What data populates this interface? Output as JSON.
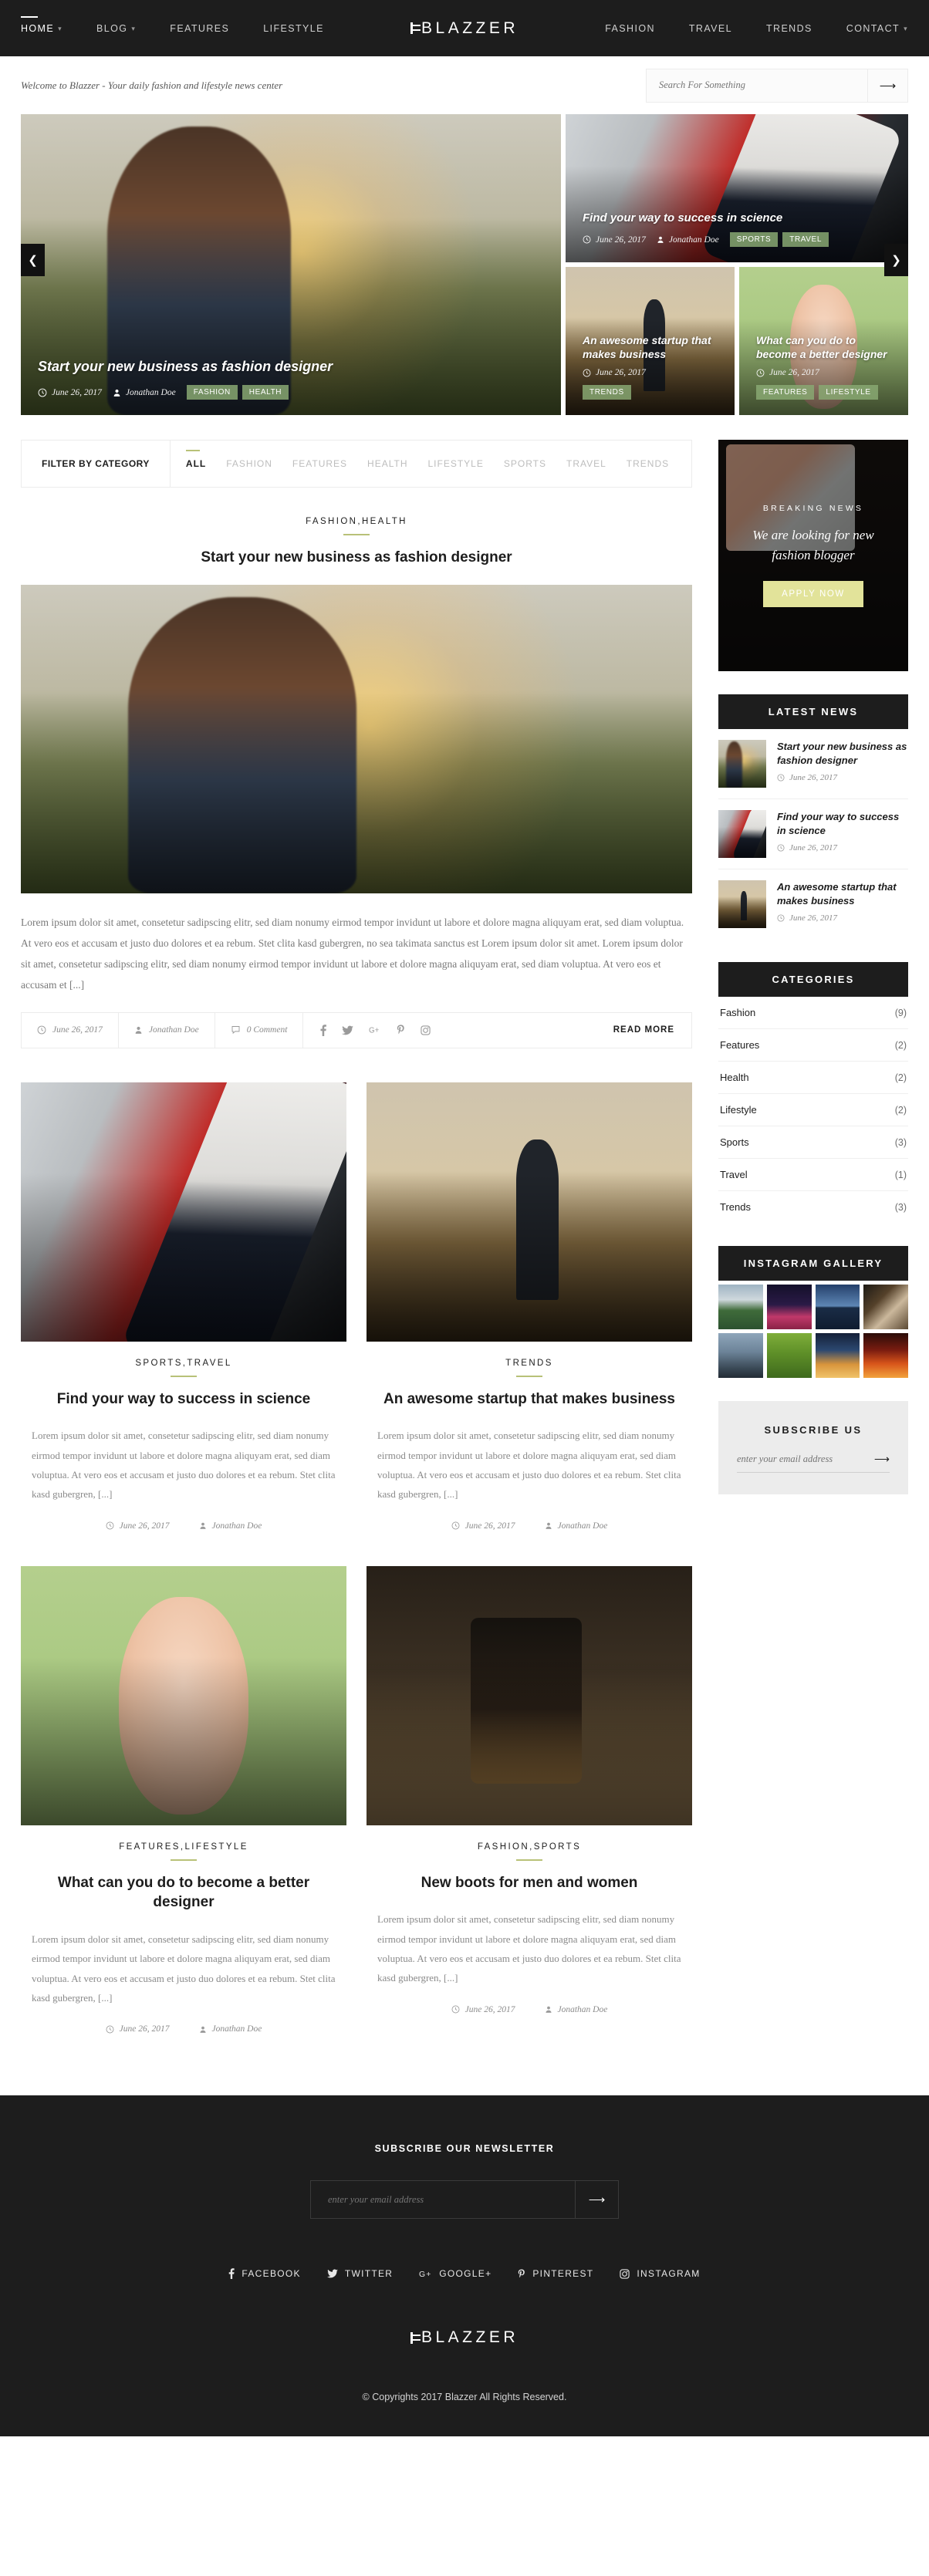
{
  "nav": {
    "left": [
      {
        "label": "HOME",
        "active": true,
        "caret": true
      },
      {
        "label": "BLOG",
        "active": false,
        "caret": true
      },
      {
        "label": "FEATURES",
        "active": false,
        "caret": false
      },
      {
        "label": "LIFESTYLE",
        "active": false,
        "caret": false
      }
    ],
    "brand": "BLAZZER",
    "right": [
      {
        "label": "FASHION",
        "active": false,
        "caret": false
      },
      {
        "label": "TRAVEL",
        "active": false,
        "caret": false
      },
      {
        "label": "TRENDS",
        "active": false,
        "caret": false
      },
      {
        "label": "CONTACT",
        "active": false,
        "caret": true
      }
    ]
  },
  "welcome": {
    "text": "Welcome to Blazzer - Your daily fashion and lifestyle news center",
    "search_placeholder": "Search For Something",
    "search_value": "",
    "search_icon": "arrow-right-icon"
  },
  "hero": {
    "prev_icon": "chevron-left-icon",
    "next_icon": "chevron-right-icon",
    "main": {
      "title": "Start your new business as fashion designer",
      "date": "June 26, 2017",
      "author": "Jonathan Doe",
      "tags": [
        "FASHION",
        "HEALTH"
      ]
    },
    "top": {
      "title": "Find your way to success in science",
      "date": "June 26, 2017",
      "author": "Jonathan Doe",
      "tags": [
        "SPORTS",
        "TRAVEL"
      ]
    },
    "small": [
      {
        "title": "An awesome startup that makes business",
        "date": "June 26, 2017",
        "tags": [
          "TRENDS"
        ]
      },
      {
        "title": "What can you do to become a better designer",
        "date": "June 26, 2017",
        "tags": [
          "FEATURES",
          "LIFESTYLE"
        ]
      }
    ]
  },
  "filter": {
    "label": "FILTER BY CATEGORY",
    "items": [
      {
        "label": "ALL",
        "active": true
      },
      {
        "label": "FASHION",
        "active": false
      },
      {
        "label": "FEATURES",
        "active": false
      },
      {
        "label": "HEALTH",
        "active": false
      },
      {
        "label": "LIFESTYLE",
        "active": false
      },
      {
        "label": "SPORTS",
        "active": false
      },
      {
        "label": "TRAVEL",
        "active": false
      },
      {
        "label": "TRENDS",
        "active": false
      }
    ]
  },
  "featured_post": {
    "categories": "FASHION,HEALTH",
    "title": "Start your new business as fashion designer",
    "excerpt": "Lorem ipsum dolor sit amet, consetetur sadipscing elitr, sed diam nonumy eirmod tempor invidunt ut labore et dolore magna aliquyam erat, sed diam voluptua. At vero eos et accusam et justo duo dolores et ea rebum. Stet clita kasd gubergren, no sea takimata sanctus est Lorem ipsum dolor sit amet. Lorem ipsum dolor sit amet, consetetur sadipscing elitr, sed diam nonumy eirmod tempor invidunt ut labore et dolore magna aliquyam erat, sed diam voluptua. At vero eos et accusam et [...]",
    "date": "June 26, 2017",
    "author": "Jonathan Doe",
    "comments": "0 Comment",
    "read_more": "READ MORE",
    "social": [
      "facebook-icon",
      "twitter-icon",
      "google-plus-icon",
      "pinterest-icon",
      "instagram-icon"
    ]
  },
  "grid_posts": [
    {
      "categories": "SPORTS,TRAVEL",
      "title": "Find your way to success in science",
      "excerpt": "Lorem ipsum dolor sit amet, consetetur sadipscing elitr, sed diam nonumy eirmod tempor invidunt ut labore et dolore magna aliquyam erat, sed diam voluptua. At vero eos et accusam et justo duo dolores et ea rebum. Stet clita kasd gubergren, [...]",
      "date": "June 26, 2017",
      "author": "Jonathan Doe"
    },
    {
      "categories": "TRENDS",
      "title": "An awesome startup that makes business",
      "excerpt": "Lorem ipsum dolor sit amet, consetetur sadipscing elitr, sed diam nonumy eirmod tempor invidunt ut labore et dolore magna aliquyam erat, sed diam voluptua. At vero eos et accusam et justo duo dolores et ea rebum. Stet clita kasd gubergren, [...]",
      "date": "June 26, 2017",
      "author": "Jonathan Doe"
    },
    {
      "categories": "FEATURES,LIFESTYLE",
      "title": "What can you do to become a better designer",
      "excerpt": "Lorem ipsum dolor sit amet, consetetur sadipscing elitr, sed diam nonumy eirmod tempor invidunt ut labore et dolore magna aliquyam erat, sed diam voluptua. At vero eos et accusam et justo duo dolores et ea rebum. Stet clita kasd gubergren, [...]",
      "date": "June 26, 2017",
      "author": "Jonathan Doe"
    },
    {
      "categories": "FASHION,SPORTS",
      "title": "New boots for men and women",
      "excerpt": "Lorem ipsum dolor sit amet, consetetur sadipscing elitr, sed diam nonumy eirmod tempor invidunt ut labore et dolore magna aliquyam erat, sed diam voluptua. At vero eos et accusam et justo duo dolores et ea rebum. Stet clita kasd gubergren, [...]",
      "date": "June 26, 2017",
      "author": "Jonathan Doe"
    }
  ],
  "sidebar": {
    "promo": {
      "kicker": "BREAKING NEWS",
      "headline": "We are looking for new fashion blogger",
      "button": "APPLY NOW",
      "button_color": "#e2e39a"
    },
    "latest_news": {
      "title": "LATEST NEWS",
      "items": [
        {
          "title": "Start your new business as fashion designer",
          "date": "June 26, 2017"
        },
        {
          "title": "Find your way to success in science",
          "date": "June 26, 2017"
        },
        {
          "title": "An awesome startup that makes business",
          "date": "June 26, 2017"
        }
      ]
    },
    "categories": {
      "title": "CATEGORIES",
      "items": [
        {
          "label": "Fashion",
          "count": "(9)"
        },
        {
          "label": "Features",
          "count": "(2)"
        },
        {
          "label": "Health",
          "count": "(2)"
        },
        {
          "label": "Lifestyle",
          "count": "(2)"
        },
        {
          "label": "Sports",
          "count": "(3)"
        },
        {
          "label": "Travel",
          "count": "(1)"
        },
        {
          "label": "Trends",
          "count": "(3)"
        }
      ]
    },
    "instagram": {
      "title": "INSTAGRAM GALLERY",
      "count": 8
    },
    "subscribe": {
      "title": "SUBSCRIBE US",
      "placeholder": "enter your email address",
      "value": "",
      "submit_icon": "arrow-right-icon"
    }
  },
  "footer": {
    "newsletter_title": "SUBSCRIBE OUR NEWSLETTER",
    "newsletter_placeholder": "enter your email address",
    "newsletter_value": "",
    "submit_icon": "arrow-right-icon",
    "social": [
      {
        "label": "FACEBOOK",
        "icon": "facebook-icon"
      },
      {
        "label": "TWITTER",
        "icon": "twitter-icon"
      },
      {
        "label": "GOOGLE+",
        "icon": "google-plus-icon"
      },
      {
        "label": "PINTEREST",
        "icon": "pinterest-icon"
      },
      {
        "label": "INSTAGRAM",
        "icon": "instagram-icon"
      }
    ],
    "brand": "BLAZZER",
    "copyright": "© Copyrights 2017 Blazzer All Rights Reserved."
  },
  "colors": {
    "dark": "#1d1d1d",
    "accent_green": "#b8c178",
    "tag_green": "#88a872",
    "promo_button": "#e2e39a"
  }
}
